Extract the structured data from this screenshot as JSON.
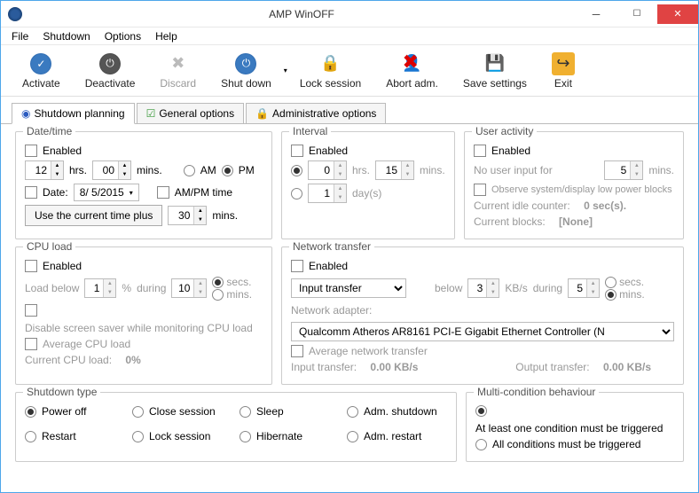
{
  "titlebar": {
    "title": "AMP WinOFF"
  },
  "menu": [
    "File",
    "Shutdown",
    "Options",
    "Help"
  ],
  "toolbar": {
    "activate": "Activate",
    "deactivate": "Deactivate",
    "discard": "Discard",
    "shutdown": "Shut down",
    "lock": "Lock session",
    "abort": "Abort adm.",
    "save": "Save settings",
    "exit": "Exit"
  },
  "tabs": [
    "Shutdown planning",
    "General options",
    "Administrative options"
  ],
  "datetime": {
    "legend": "Date/time",
    "enabled": "Enabled",
    "hrs_val": "12",
    "hrs": "hrs.",
    "mins_val": "00",
    "mins": "mins.",
    "am": "AM",
    "pm": "PM",
    "date_label": "Date:",
    "date_val": "8/ 5/2015",
    "ampm_time": "AM/PM time",
    "use_current": "Use the current time plus",
    "plus_val": "30",
    "plus_mins": "mins."
  },
  "interval": {
    "legend": "Interval",
    "enabled": "Enabled",
    "hrs_val": "0",
    "hrs": "hrs.",
    "mins_val": "15",
    "mins": "mins.",
    "days_val": "1",
    "days": "day(s)"
  },
  "user_activity": {
    "legend": "User activity",
    "enabled": "Enabled",
    "no_input": "No user input for",
    "val": "5",
    "mins": "mins.",
    "observe": "Observe system/display low power blocks",
    "idle": "Current idle counter:",
    "idle_val": "0 sec(s).",
    "blocks": "Current blocks:",
    "blocks_val": "[None]"
  },
  "cpu": {
    "legend": "CPU load",
    "enabled": "Enabled",
    "load_below": "Load below",
    "below_val": "1",
    "pct": "%",
    "during": "during",
    "during_val": "10",
    "secs": "secs.",
    "mins": "mins.",
    "disable_ss": "Disable screen saver while monitoring CPU load",
    "avg": "Average CPU load",
    "current": "Current CPU load:",
    "current_val": "0%"
  },
  "net": {
    "legend": "Network transfer",
    "enabled": "Enabled",
    "direction": "Input transfer",
    "below": "below",
    "below_val": "3",
    "kbs": "KB/s",
    "during": "during",
    "during_val": "5",
    "secs": "secs.",
    "mins": "mins.",
    "adapter_label": "Network adapter:",
    "adapter": "Qualcomm Atheros AR8161 PCI-E Gigabit Ethernet Controller (N",
    "avg": "Average network transfer",
    "in": "Input transfer:",
    "in_val": "0.00 KB/s",
    "out": "Output transfer:",
    "out_val": "0.00 KB/s"
  },
  "shutdown_type": {
    "legend": "Shutdown type",
    "poweroff": "Power off",
    "close": "Close session",
    "sleep": "Sleep",
    "admshut": "Adm. shutdown",
    "restart": "Restart",
    "lock": "Lock session",
    "hibernate": "Hibernate",
    "admrestart": "Adm. restart"
  },
  "multi": {
    "legend": "Multi-condition behaviour",
    "one": "At least one condition must be triggered",
    "all": "All conditions must be triggered"
  }
}
